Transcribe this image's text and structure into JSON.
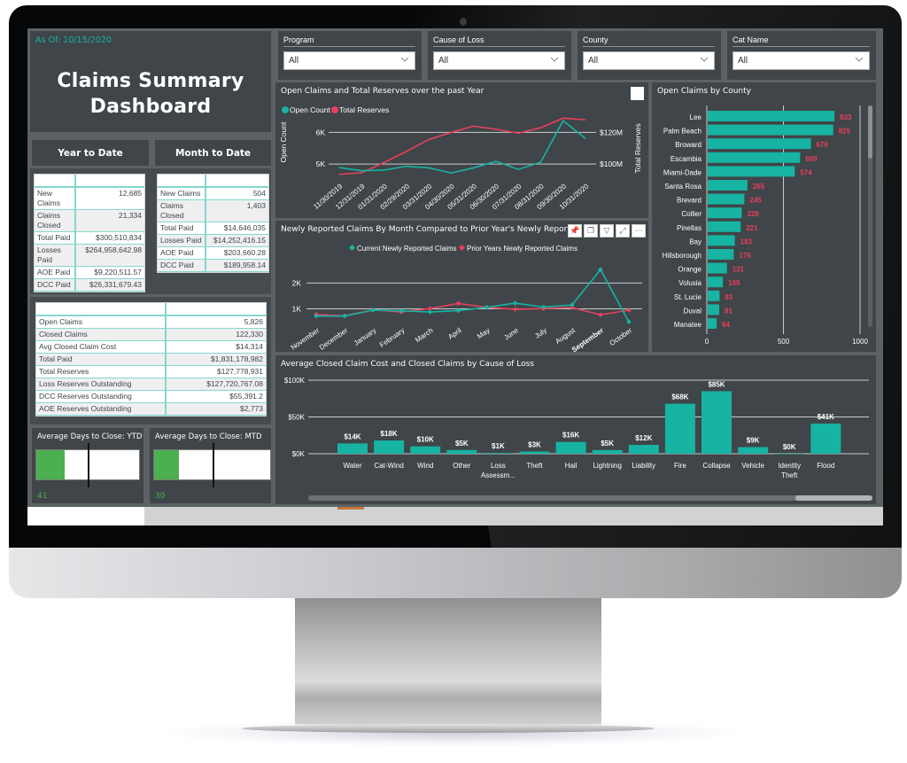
{
  "header": {
    "as_of": "As Of: 10/15/2020",
    "title_line1": "Claims Summary",
    "title_line2": "Dashboard"
  },
  "periods": {
    "ytd_label": "Year to Date",
    "mtd_label": "Month to Date"
  },
  "ytd_table": [
    {
      "label": "New Claims",
      "value": "12,685"
    },
    {
      "label": "Claims Closed",
      "value": "21,334"
    },
    {
      "label": "Total Paid",
      "value": "$300,510,834"
    },
    {
      "label": "Losses Paid",
      "value": "$264,958,642.98"
    },
    {
      "label": "AOE Paid",
      "value": "$9,220,511.57"
    },
    {
      "label": "DCC Paid",
      "value": "$26,331,679.43"
    }
  ],
  "mtd_table": [
    {
      "label": "New Claims",
      "value": "504"
    },
    {
      "label": "Claims Closed",
      "value": "1,403"
    },
    {
      "label": "Total Paid",
      "value": "$14,646,035"
    },
    {
      "label": "Losses Paid",
      "value": "$14,252,416.15"
    },
    {
      "label": "AOE Paid",
      "value": "$203,660.28"
    },
    {
      "label": "DCC Paid",
      "value": "$189,958.14"
    }
  ],
  "totals_table": [
    {
      "label": "Open Claims",
      "value": "5,826"
    },
    {
      "label": "Closed Claims",
      "value": "122,330"
    },
    {
      "label": "Avg Closed Claim Cost",
      "value": "$14,314"
    },
    {
      "label": "Total Paid",
      "value": "$1,831,178,982"
    },
    {
      "label": "Total Reserves",
      "value": "$127,778,931"
    },
    {
      "label": "Loss Reserves Outstanding",
      "value": "$127,720,767.08"
    },
    {
      "label": "DCC Reserves Outstanding",
      "value": "$55,391.2"
    },
    {
      "label": "AOE Reserves Outstanding",
      "value": "$2,773"
    }
  ],
  "gauges": [
    {
      "title": "Average Days to Close: YTD",
      "value": "41",
      "fill_fraction": 0.28,
      "target_fraction": 0.5
    },
    {
      "title": "Average Days to Close: MTD",
      "value": "30",
      "fill_fraction": 0.21,
      "target_fraction": 0.5
    }
  ],
  "slicers": [
    {
      "label": "Program",
      "value": "All"
    },
    {
      "label": "Cause of Loss",
      "value": "All"
    },
    {
      "label": "County",
      "value": "All"
    },
    {
      "label": "Cat Name",
      "value": "All"
    }
  ],
  "visual_toolbar": [
    "pin-icon",
    "copy-icon",
    "filter-icon",
    "focus-mode-icon",
    "more-options-icon"
  ],
  "colors": {
    "teal": "#17b3a3",
    "red": "#e8405e",
    "gauge_green": "#4caf50"
  },
  "chart_data": [
    {
      "type": "line",
      "title": "Open Claims and Total Reserves over the past Year",
      "xlabel": "",
      "ylabel": "Open Count",
      "y2label": "Total Reserves",
      "x": [
        "11/30/2019",
        "12/31/2019",
        "01/31/2020",
        "02/29/2020",
        "03/31/2020",
        "04/30/2020",
        "05/31/2020",
        "06/30/2020",
        "07/31/2020",
        "08/31/2020",
        "09/30/2020",
        "10/31/2020"
      ],
      "y_ticks": [
        "5K",
        "6K"
      ],
      "y2_ticks": [
        "$100M",
        "$120M"
      ],
      "legend": "top-left",
      "series": [
        {
          "name": "Open Count",
          "axis": "left",
          "color": "#17b3a3",
          "values": [
            4890,
            4790,
            4810,
            4930,
            4880,
            4720,
            4880,
            5090,
            4830,
            5060,
            6370,
            5810
          ]
        },
        {
          "name": "Total Reserves",
          "axis": "right",
          "color": "#e8405e",
          "values": [
            93.5,
            94.5,
            101,
            108,
            115.5,
            120,
            124,
            122,
            119.5,
            123,
            129,
            128
          ]
        }
      ],
      "ylim": [
        4500,
        6600
      ],
      "y2lim": [
        90,
        132
      ]
    },
    {
      "type": "line",
      "title": "Newly Reported Claims By Month Compared to Prior Year's Newly Reported Claims",
      "xlabel": "",
      "ylabel": "",
      "x": [
        "November",
        "December",
        "January",
        "February",
        "March",
        "April",
        "May",
        "June",
        "July",
        "August",
        "September",
        "October"
      ],
      "highlighted_x": "September",
      "y_ticks": [
        "1K",
        "2K"
      ],
      "legend": "top-center",
      "series": [
        {
          "name": "Current Newly Reported Claims",
          "color": "#17b3a3",
          "values": [
            720,
            720,
            950,
            920,
            880,
            930,
            1060,
            1220,
            1070,
            1150,
            2520,
            500
          ]
        },
        {
          "name": "Prior Years Newly Reported Claims",
          "color": "#e8405e",
          "values": [
            780,
            730,
            960,
            880,
            1010,
            1210,
            1060,
            980,
            1010,
            1050,
            770,
            950
          ]
        }
      ],
      "ylim": [
        400,
        2700
      ]
    },
    {
      "type": "bar",
      "orientation": "horizontal",
      "title": "Open Claims by County",
      "categories": [
        "Lee",
        "Palm Beach",
        "Broward",
        "Escambia",
        "Miami-Dade",
        "Santa Rosa",
        "Brevard",
        "Collier",
        "Pinellas",
        "Bay",
        "Hillsborough",
        "Orange",
        "Volusia",
        "St. Lucie",
        "Duval",
        "Manatee"
      ],
      "values": [
        833,
        825,
        679,
        609,
        574,
        265,
        245,
        228,
        221,
        183,
        176,
        131,
        105,
        83,
        81,
        64
      ],
      "x_ticks": [
        "0",
        "500",
        "1000"
      ],
      "xlim": [
        0,
        1000
      ],
      "bar_color": "#17b3a3",
      "label_color": "#e8405e"
    },
    {
      "type": "bar",
      "title": "Average Closed Claim Cost and Closed Claims by Cause of Loss",
      "categories": [
        "Water",
        "Cat-Wind",
        "Wind",
        "Other",
        "Loss Assessm...",
        "Theft",
        "Hail",
        "Lightning",
        "Liability",
        "Fire",
        "Collapse",
        "Vehicle",
        "Identity Theft",
        "Flood"
      ],
      "values": [
        14,
        18,
        10,
        5,
        1,
        3,
        16,
        5,
        12,
        68,
        85,
        9,
        0,
        41
      ],
      "data_labels": [
        "$14K",
        "$18K",
        "$10K",
        "$5K",
        "$1K",
        "$3K",
        "$16K",
        "$5K",
        "$12K",
        "$68K",
        "$85K",
        "$9K",
        "$0K",
        "$41K"
      ],
      "y_ticks": [
        "$0K",
        "$50K",
        "$100K"
      ],
      "ylim": [
        0,
        100
      ],
      "unit": "$K",
      "bar_color": "#17b3a3"
    }
  ]
}
